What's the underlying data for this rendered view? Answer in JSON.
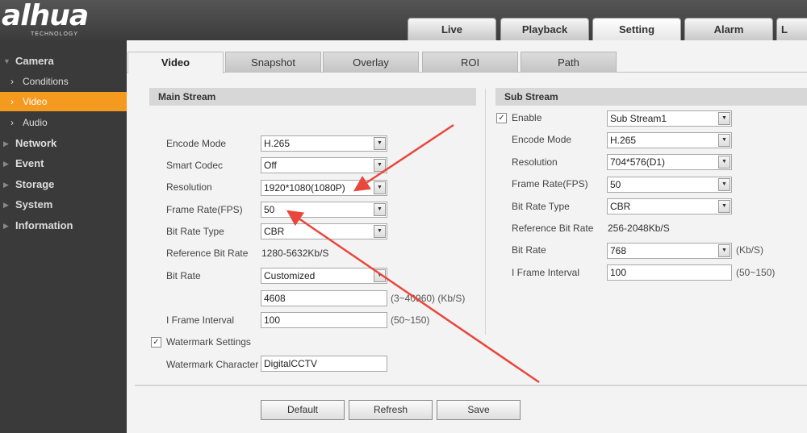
{
  "header": {
    "logo_text": "alhua",
    "logo_sub": "TECHNOLOGY",
    "tabs": [
      "Live",
      "Playback",
      "Setting",
      "Alarm",
      "L"
    ]
  },
  "sidebar": {
    "camera": "Camera",
    "conditions": "Conditions",
    "video": "Video",
    "audio": "Audio",
    "network": "Network",
    "event": "Event",
    "storage": "Storage",
    "system": "System",
    "information": "Information"
  },
  "tabs": [
    "Video",
    "Snapshot",
    "Overlay",
    "ROI",
    "Path"
  ],
  "main_stream": {
    "title": "Main Stream",
    "encode_mode_label": "Encode Mode",
    "encode_mode": "H.265",
    "smart_codec_label": "Smart Codec",
    "smart_codec": "Off",
    "resolution_label": "Resolution",
    "resolution": "1920*1080(1080P)",
    "frame_rate_label": "Frame Rate(FPS)",
    "frame_rate": "50",
    "bit_rate_type_label": "Bit Rate Type",
    "bit_rate_type": "CBR",
    "ref_bit_rate_label": "Reference Bit Rate",
    "ref_bit_rate": "1280-5632Kb/S",
    "bit_rate_label": "Bit Rate",
    "bit_rate_mode": "Customized",
    "bit_rate_value": "4608",
    "bit_rate_hint": "(3~40960) (Kb/S)",
    "iframe_label": "I Frame Interval",
    "iframe_value": "100",
    "iframe_hint": "(50~150)",
    "watermark_settings_label": "Watermark Settings",
    "watermark_char_label": "Watermark Character",
    "watermark_char": "DigitalCCTV"
  },
  "sub_stream": {
    "title": "Sub Stream",
    "enable_label": "Enable",
    "stream": "Sub Stream1",
    "encode_mode_label": "Encode Mode",
    "encode_mode": "H.265",
    "resolution_label": "Resolution",
    "resolution": "704*576(D1)",
    "frame_rate_label": "Frame Rate(FPS)",
    "frame_rate": "50",
    "bit_rate_type_label": "Bit Rate Type",
    "bit_rate_type": "CBR",
    "ref_bit_rate_label": "Reference Bit Rate",
    "ref_bit_rate": "256-2048Kb/S",
    "bit_rate_label": "Bit Rate",
    "bit_rate": "768",
    "bit_rate_unit": "(Kb/S)",
    "iframe_label": "I Frame Interval",
    "iframe_value": "100",
    "iframe_hint": "(50~150)"
  },
  "buttons": {
    "default": "Default",
    "refresh": "Refresh",
    "save": "Save"
  },
  "colors": {
    "active_nav": "#f39a1f",
    "annotation_arrow": "#e8473b"
  }
}
